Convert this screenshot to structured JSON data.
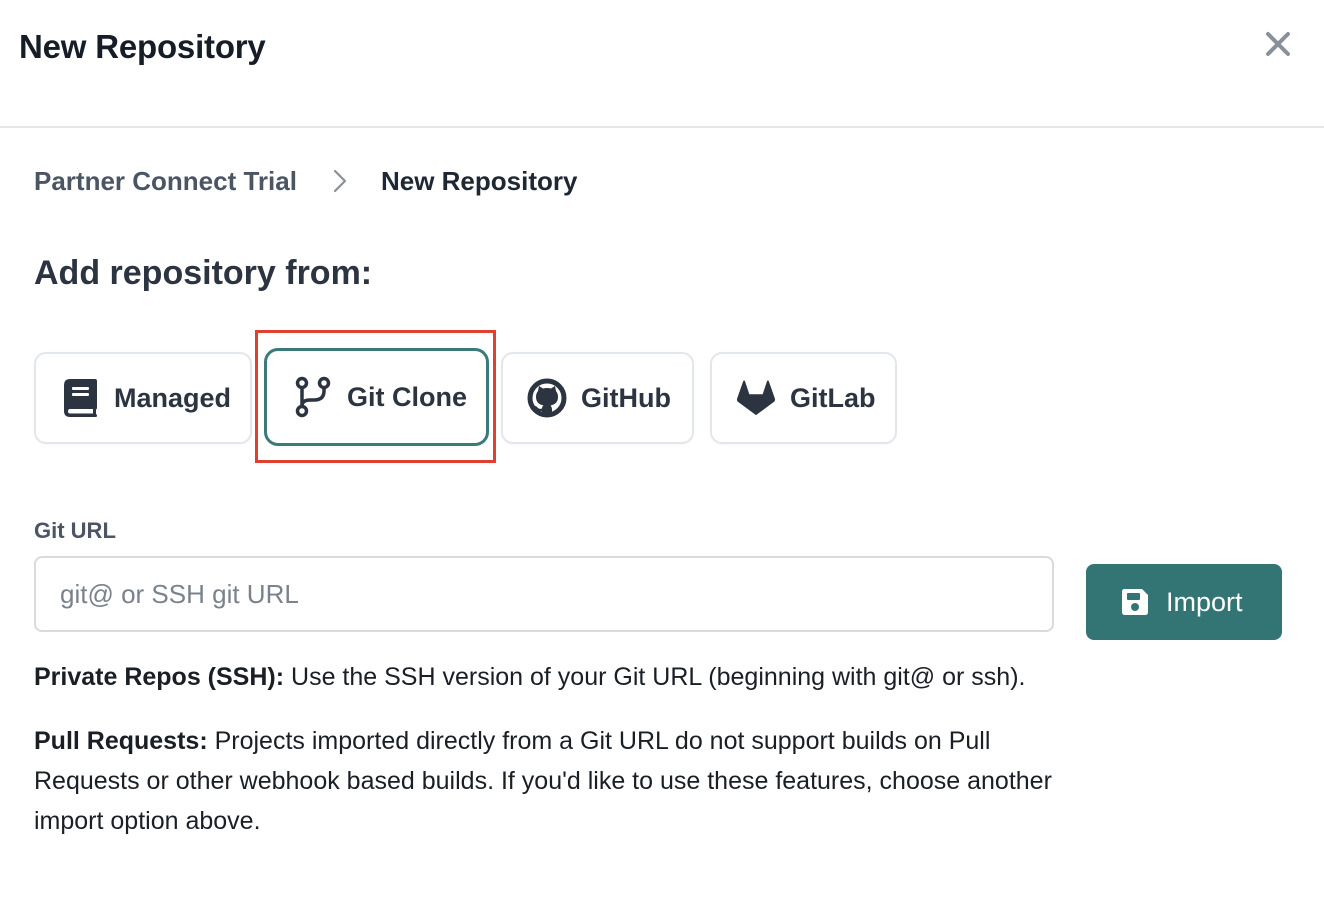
{
  "header": {
    "title": "New Repository",
    "close_icon": "close-icon"
  },
  "breadcrumb": {
    "parent": "Partner Connect Trial",
    "separator_icon": "chevron-right-icon",
    "current": "New Repository"
  },
  "section": {
    "heading": "Add repository from:"
  },
  "sources": [
    {
      "label": "Managed",
      "icon": "book-icon"
    },
    {
      "label": "Git Clone",
      "icon": "git-branch-icon",
      "selected": true
    },
    {
      "label": "GitHub",
      "icon": "github-icon"
    },
    {
      "label": "GitLab",
      "icon": "gitlab-icon"
    }
  ],
  "git_url": {
    "label": "Git URL",
    "value": "",
    "placeholder": "git@ or SSH git URL"
  },
  "import_button": {
    "label": "Import",
    "icon": "save-icon"
  },
  "help": {
    "ssh_title": "Private Repos (SSH):",
    "ssh_text": " Use the SSH version of your Git URL (beginning with git@ or ssh).",
    "pr_title": "Pull Requests:",
    "pr_text": " Projects imported directly from a Git URL do not support builds on Pull Requests or other webhook based builds. If you'd like to use these features, choose another import option above."
  },
  "colors": {
    "accent": "#337575",
    "selected_border": "#3b7a7a",
    "highlight": "#e0412f",
    "text_dark": "#1f2733",
    "text_muted": "#4b5563"
  }
}
